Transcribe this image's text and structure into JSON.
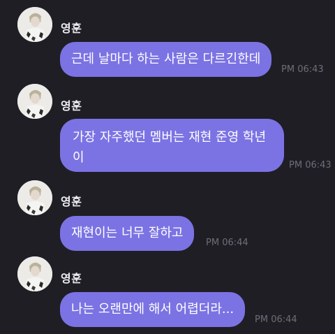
{
  "chat": {
    "messages": [
      {
        "sender": "영훈",
        "text": "근데 날마다 하는 사람은 다르긴한데",
        "time": "PM 06:43"
      },
      {
        "sender": "영훈",
        "text": "가장 자주했던 멤버는 재현 준영 학년이",
        "time": "PM 06:43"
      },
      {
        "sender": "영훈",
        "text": "재현이는 너무 잘하고",
        "time": "PM 06:44"
      },
      {
        "sender": "영훈",
        "text": "나는 오랜만에 해서 어렵더라...",
        "time": "PM 06:44"
      }
    ]
  }
}
